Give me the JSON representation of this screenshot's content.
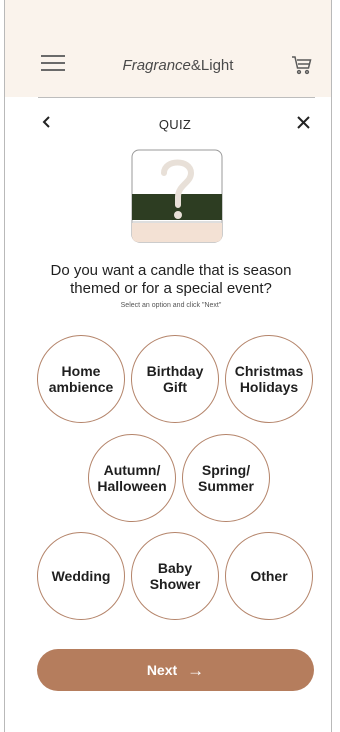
{
  "header": {
    "brand_part1": "Fragrance",
    "brand_part2": "&Light"
  },
  "nav": {
    "title": "QUIZ"
  },
  "question": {
    "text": "Do you want a candle that is season themed or for a special event?",
    "hint": "Select an option and click \"Next\""
  },
  "options": [
    "Home\nambience",
    "Birthday\nGift",
    "Christmas\nHolidays",
    "Autumn/\nHalloween",
    "Spring/\nSummer",
    "Wedding",
    "Baby\nShower",
    "Other"
  ],
  "next_button": {
    "label": "Next",
    "arrow": "→"
  },
  "colors": {
    "accent": "#b57d5d",
    "header_bg": "#faf3ec",
    "option_border": "#b4846a",
    "candle_band": "#2d3d22"
  },
  "icons": {
    "menu": "hamburger-menu-icon",
    "cart": "shopping-cart-icon",
    "back": "chevron-left-icon",
    "close": "close-icon",
    "next": "arrow-right-icon"
  }
}
